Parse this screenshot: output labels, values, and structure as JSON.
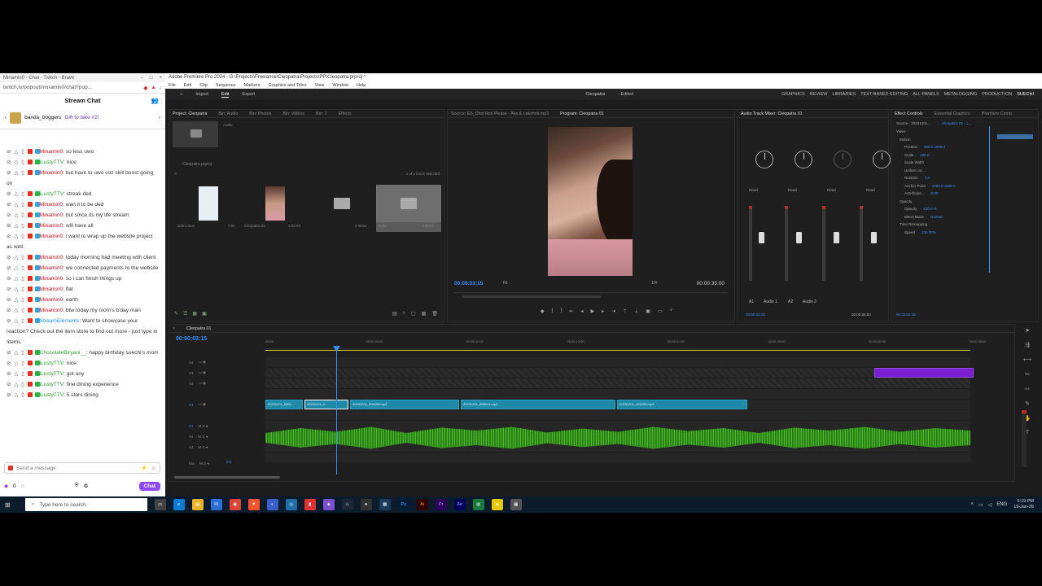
{
  "chat": {
    "tab_title": "Minamin0 - Chat - Twitch - Brave",
    "url": "twitch.tv/popout/minamin0/chat?pop...",
    "header": "Stream Chat",
    "gift_user": "banda_boggers",
    "gift_text": "Gift to take #2!",
    "messages": [
      {
        "user": "Minamin0",
        "text": ": so less uwo",
        "color": "red"
      },
      {
        "user": "iLustyTTV",
        "text": ": nice",
        "color": "green"
      },
      {
        "user": "Minamin0",
        "text": ": but have to uwo coz skill boost going on",
        "color": "red"
      },
      {
        "user": "iLustyTTV",
        "text": ": streak ded",
        "color": "green"
      },
      {
        "user": "Minamin0",
        "text": ": wan it to be ded",
        "color": "red"
      },
      {
        "user": "Minamin0",
        "text": ": but since its my life stream",
        "color": "red"
      },
      {
        "user": "Minamin0",
        "text": ": will have all",
        "color": "red"
      },
      {
        "user": "Minamin0",
        "text": ": i want to wrap up the website project as well",
        "color": "red"
      },
      {
        "user": "Minamin0",
        "text": ": today morning had meeting with client",
        "color": "red"
      },
      {
        "user": "Minamin0",
        "text": ": we connected payments to the website",
        "color": "red"
      },
      {
        "user": "Minamin0",
        "text": ": so i can finish things up",
        "color": "red"
      },
      {
        "user": "Minamin0",
        "text": ": flat",
        "color": "red"
      },
      {
        "user": "Minamin0",
        "text": ": earth",
        "color": "red"
      },
      {
        "user": "Minamin0",
        "text": ": btw today my mom's b'day man",
        "color": "red"
      },
      {
        "user": "StreamElements",
        "text": ": Want to showcase your reaction? Check out the item store to find out more - just type in !items",
        "color": "blue"
      },
      {
        "user": "ChocolateBiryani__",
        "text": ": happy birthday suechi's mom",
        "color": "green"
      },
      {
        "user": "iLustyTTV",
        "text": ": nice",
        "color": "green"
      },
      {
        "user": "iLustyTTV",
        "text": ": got any",
        "color": "green"
      },
      {
        "user": "iLustyTTV",
        "text": ": fine dining experience",
        "color": "green"
      },
      {
        "user": "iLustyTTV",
        "text": ": 5 stars dining",
        "color": "green"
      }
    ],
    "input_placeholder": "Send a message",
    "points": "0",
    "chat_button": "Chat"
  },
  "premiere": {
    "title": "Adobe Premiere Pro 2024 - G:\\Projects\\Freelance\\Cleopatra\\Projects\\PP\\Cleopatra.prproj *",
    "menu": [
      "File",
      "Edit",
      "Clip",
      "Sequence",
      "Markers",
      "Graphics and Titles",
      "View",
      "Window",
      "Help"
    ],
    "mode_tabs": [
      "Import",
      "Edit",
      "Export"
    ],
    "active_mode": "Edit",
    "project_name": "Cleopatra",
    "project_status": "- Edited",
    "workspaces": [
      "GRAPHICS",
      "REVIEW",
      "LIBRARIES",
      "TEXT-BASED EDITING",
      "ALL PANELS",
      "METALOGGING",
      "PRODUCTION",
      "SUECHI"
    ],
    "project_tabs": [
      "Project: Cleopatra",
      "Bin: Audio",
      "Bin: Photos",
      "Bin: Videos",
      "Bin: 1",
      "Effects"
    ],
    "project_file": "Cleopatra.prproj",
    "items_selected": "1 of 4 items selected",
    "bins": [
      {
        "name": "Outro.mov",
        "meta": "7;01"
      },
      {
        "name": "Cleopatra 01",
        "meta": "1:02:03"
      },
      {
        "name": "",
        "meta": "2 items"
      },
      {
        "name": "Audio",
        "meta": "4 items"
      }
    ],
    "audio_bin_label": "Audio",
    "source_tab": "Source: ES_Dhol Roll Please - Aks & Lakshmi.mp3",
    "program_tab": "Program: Cleopatra 01",
    "program_tc": "00:00:03:15",
    "program_fit": "Fit",
    "program_res": "1/4",
    "program_duration": "00:00:35:00",
    "mixer_tab": "Audio Track Mixer: Cleopatra 01",
    "mixer_labels": [
      "A1",
      "Audio 1",
      "A2",
      "Audio 2"
    ],
    "mixer_modes": [
      "Read",
      "Read",
      "Read",
      "Read"
    ],
    "mixer_tc": "00:00:03:15",
    "mixer_end": "00:00:35:00",
    "fx_tab": "Effect Controls",
    "fx_tab2": "Essential Graphics",
    "fx_tab3": "Premiere Comp",
    "fx_source": "Source - 20231201...",
    "fx_clip": "Cleopatra 01 - 1...",
    "fx_rows": [
      {
        "name": "Video",
        "val": ""
      },
      {
        "name": "Motion",
        "val": ""
      },
      {
        "name": "Position",
        "val": "960.0  1509.0"
      },
      {
        "name": "Scale",
        "val": "100.0"
      },
      {
        "name": "Scale Width",
        "val": ""
      },
      {
        "name": "Uniform Sc...",
        "val": ""
      },
      {
        "name": "Rotation",
        "val": "0.0"
      },
      {
        "name": "Anchor Point",
        "val": "1080.0  1920.0"
      },
      {
        "name": "Anti-flicker...",
        "val": "0.00"
      },
      {
        "name": "Opacity",
        "val": ""
      },
      {
        "name": "Opacity",
        "val": "100.0 %"
      },
      {
        "name": "Blend Mode",
        "val": "Normal"
      },
      {
        "name": "Time Remapping",
        "val": ""
      },
      {
        "name": "Speed",
        "val": "100.00%"
      }
    ],
    "fx_tc": "00:00:03:15",
    "sequence_tab": "Cleopatra 01",
    "timeline_tc": "00:00:03:15",
    "ruler_ticks": [
      "00:00",
      "00:00:05:00",
      "00:00:10:00",
      "00:00:15:00",
      "00:00:20:00",
      "00:00:25:00",
      "00:00:30:00",
      "00:00:35:00"
    ],
    "tracks": [
      "V4",
      "V3",
      "V2",
      "V1",
      "A1",
      "A2",
      "A3",
      "Mix"
    ],
    "clips": [
      "20231201_0851...",
      "20231201_0...",
      "20231201_094229.mp4",
      "20231201_095013.mp4",
      "20231201_101630.mp4"
    ],
    "mix_val": "0.0"
  },
  "taskbar": {
    "search_placeholder": "Type here to search",
    "time": "5:19 PM",
    "date": "19-Jan-26",
    "lang": "ENG"
  }
}
